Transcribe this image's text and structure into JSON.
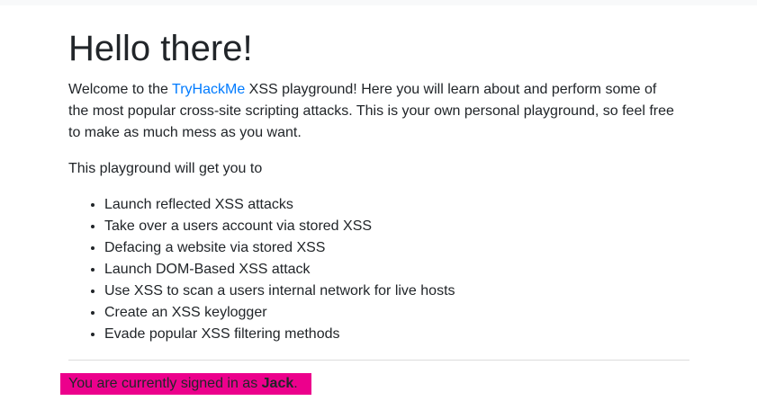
{
  "heading": "Hello there!",
  "intro": {
    "before_link": "Welcome to the ",
    "link_text": "TryHackMe",
    "after_link": " XSS playground! Here you will learn about and perform some of the most popular cross-site scripting attacks. This is your own personal playground, so feel free to make as much mess as you want."
  },
  "lead_text": "This playground will get you to",
  "features": [
    "Launch reflected XSS attacks",
    "Take over a users account via stored XSS",
    "Defacing a website via stored XSS",
    "Launch DOM-Based XSS attack",
    "Use XSS to scan a users internal network for live hosts",
    "Create an XSS keylogger",
    "Evade popular XSS filtering methods"
  ],
  "signed_in": {
    "prefix": "You are currently signed in as ",
    "username": "Jack",
    "suffix": "."
  },
  "colors": {
    "link": "#007bff",
    "highlight": "#ec008c"
  }
}
